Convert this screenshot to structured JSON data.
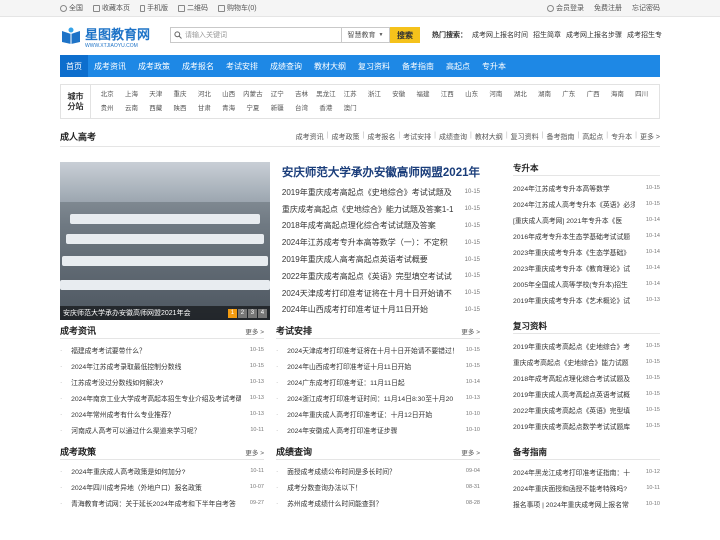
{
  "topbar": {
    "left": [
      "全国",
      "收藏本页",
      "手机版",
      "二维码",
      "购物车(0)"
    ],
    "right": [
      "会员登录",
      "免费注册",
      "忘记密码"
    ]
  },
  "logo": {
    "name": "星图教育网",
    "url_text": "WWW.XTJIAOYU.COM"
  },
  "search": {
    "placeholder": "请输入关键词",
    "scope": "智慧教育",
    "button": "搜索"
  },
  "hot": {
    "label": "热门搜索：",
    "items": [
      "成考网上报名时间",
      "招生简章",
      "成考网上报名步骤",
      "成考招生专"
    ]
  },
  "nav": [
    "首页",
    "成考资讯",
    "成考政策",
    "成考报名",
    "考试安排",
    "成绩查询",
    "教材大纲",
    "复习资料",
    "备考指南",
    "高起点",
    "专升本"
  ],
  "city": {
    "label": "城市\n分站",
    "items": [
      "北京",
      "上海",
      "天津",
      "重庆",
      "河北",
      "山西",
      "内蒙古",
      "辽宁",
      "吉林",
      "黑龙江",
      "江苏",
      "浙江",
      "安徽",
      "福建",
      "江西",
      "山东",
      "河南",
      "湖北",
      "湖南",
      "广东",
      "广西",
      "海南",
      "四川",
      "贵州",
      "云南",
      "西藏",
      "陕西",
      "甘肃",
      "青海",
      "宁夏",
      "新疆",
      "台湾",
      "香港",
      "澳门"
    ]
  },
  "section": {
    "title": "成人高考",
    "links": [
      "成考资讯",
      "成考政策",
      "成考报名",
      "考试安排",
      "成绩查询",
      "教材大纲",
      "复习资料",
      "备考指南",
      "高起点",
      "专升本",
      "更多 >"
    ]
  },
  "focus": {
    "caption": "安庆师范大学承办安徽高师网盟2021年会",
    "pages": [
      "1",
      "2",
      "3",
      "4"
    ],
    "headline": "安庆师范大学承办安徽高师网盟2021年",
    "items": [
      {
        "t": "2019年重庆成考高起点《史地综合》考试试题及",
        "d": "10-15"
      },
      {
        "t": "重庆成考高起点《史地综合》能力试题及答案1-1",
        "d": "10-15"
      },
      {
        "t": "2018年成考高起点理化综合考试试题及答案",
        "d": "10-15"
      },
      {
        "t": "2024年江苏成考专升本高等数学（一）：不定积",
        "d": "10-15"
      },
      {
        "t": "2019年重庆成人高考高起点英语考试概要",
        "d": "10-15"
      },
      {
        "t": "2022年重庆成考高起点《英语》完型填空考试试",
        "d": "10-15"
      },
      {
        "t": "2024天津成考打印准考证将在十月十日开始请不",
        "d": "10-15"
      },
      {
        "t": "2024年山西成考打印准考证十月11日开始",
        "d": "10-15"
      }
    ]
  },
  "blocks": [
    {
      "title": "成考资讯",
      "more": "更多 >",
      "items": [
        {
          "t": "福建成考考试要带什么？",
          "d": "10-15"
        },
        {
          "t": "2024年江苏成考录取最低控制分数线",
          "d": "10-15"
        },
        {
          "t": "江苏成考没过分数线如何解决?",
          "d": "10-13"
        },
        {
          "t": "2024年南京工业大学成考高起本招生专业介绍及考试考碼",
          "d": "10-13"
        },
        {
          "t": "2024年常州成考有什么专业推荐？",
          "d": "10-13"
        },
        {
          "t": "河南成人高考可以通过什么渠道来学习呢？",
          "d": "10-11"
        }
      ]
    },
    {
      "title": "考试安排",
      "more": "更多 >",
      "items": [
        {
          "t": "2024天津成考打印准考证将在十月十日开始请不要错过！",
          "d": "10-15"
        },
        {
          "t": "2024年山西成考打印准考证十月11日开始",
          "d": "10-15"
        },
        {
          "t": "2024广东成考打印准考证：11月11日起",
          "d": "10-14"
        },
        {
          "t": "2024浙江成考打印准考证时间：11月14日8:30至十月20",
          "d": "10-13"
        },
        {
          "t": "2024年重庆成人高考打印准考证：十月12日开始",
          "d": "10-10"
        },
        {
          "t": "2024年安徽成人高考打印准考证步骤",
          "d": "10-10"
        }
      ]
    },
    {
      "title": "成考政策",
      "more": "更多 >",
      "items": [
        {
          "t": "2024年重庆成人高考政策是如何加分?",
          "d": "10-11"
        },
        {
          "t": "2024年四川成考异地（外地户口）报名政策",
          "d": "10-07"
        },
        {
          "t": "青海教育考试网：关于延长2024年成考和下半年自考答",
          "d": "09-27"
        }
      ]
    },
    {
      "title": "成绩查询",
      "more": "更多 >",
      "items": [
        {
          "t": "面授成考成绩公布时间是多长时间？",
          "d": "09-04"
        },
        {
          "t": "成考分数查询办法以下！",
          "d": "08-31"
        },
        {
          "t": "苏州成考成绩什么时间能查到？",
          "d": "08-28"
        }
      ]
    }
  ],
  "side": [
    {
      "title": "专升本",
      "items": [
        {
          "t": "2024年江苏成考专升本高等数学",
          "d": "10-15"
        },
        {
          "t": "2024年江苏成人高考专升本《英语》必须",
          "d": "10-15"
        },
        {
          "t": "[重庆成人高考网] 2021年专升本《医",
          "d": "10-14"
        },
        {
          "t": "2016年成考专升本生态学基础考试试题",
          "d": "10-14"
        },
        {
          "t": "2023年重庆成考专升本《生态学基础》",
          "d": "10-14"
        },
        {
          "t": "2023年重庆成考专升本《教育理论》试",
          "d": "10-14"
        },
        {
          "t": "2005年全国成人高等学校(专升本)招生",
          "d": "10-14"
        },
        {
          "t": "2019年重庆成考专升本《艺术概论》试",
          "d": "10-13"
        }
      ]
    },
    {
      "title": "复习资料",
      "items": [
        {
          "t": "2019年重庆成考高起点《史地综合》考",
          "d": "10-15"
        },
        {
          "t": "重庆成考高起点《史地综合》能力试题",
          "d": "10-15"
        },
        {
          "t": "2018年成考高起点理化综合考试试题及",
          "d": "10-15"
        },
        {
          "t": "2019年重庆成人高考高起点英语考试概",
          "d": "10-15"
        },
        {
          "t": "2022年重庆成考高起点《英语》完型填",
          "d": "10-15"
        },
        {
          "t": "2019年重庆成考高起点数学考试试题库",
          "d": "10-15"
        }
      ]
    },
    {
      "title": "备考指南",
      "items": [
        {
          "t": "2024年黑龙江成考打印准考证指南：十",
          "d": "10-12"
        },
        {
          "t": "2024年重庆面授和函授不能考特殊吗?",
          "d": "10-11"
        },
        {
          "t": "报名事项 | 2024年重庆成考网上报名常",
          "d": "10-10"
        }
      ]
    }
  ]
}
